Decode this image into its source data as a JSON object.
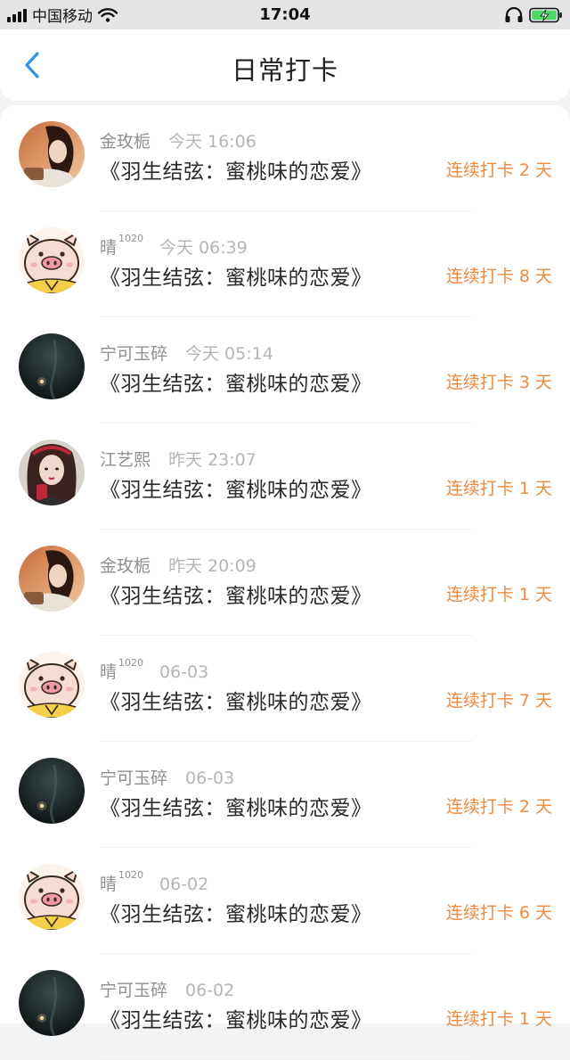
{
  "status_bar": {
    "carrier": "中国移动",
    "time": "17:04",
    "battery_charging": true
  },
  "header": {
    "title": "日常打卡",
    "back_icon": "chevron-left-icon"
  },
  "colors": {
    "accent": "#2f95e8",
    "streak": "#f08a3e",
    "name_gray": "#8f8f8f",
    "time_gray": "#b5b5b5"
  },
  "checkins": [
    {
      "name": "金玫栀",
      "name_sup": "",
      "time": "今天 16:06",
      "book": "《羽生结弦：蜜桃味的恋爱》",
      "streak": "连续打卡 2 天",
      "avatar": "girl-warm"
    },
    {
      "name": "晴",
      "name_sup": "1020",
      "time": "今天 06:39",
      "book": "《羽生结弦：蜜桃味的恋爱》",
      "streak": "连续打卡 8 天",
      "avatar": "pig"
    },
    {
      "name": "宁可玉碎",
      "name_sup": "",
      "time": "今天 05:14",
      "book": "《羽生结弦：蜜桃味的恋爱》",
      "streak": "连续打卡 3 天",
      "avatar": "dark"
    },
    {
      "name": "江艺熙",
      "name_sup": "",
      "time": "昨天 23:07",
      "book": "《羽生结弦：蜜桃味的恋爱》",
      "streak": "连续打卡 1 天",
      "avatar": "girl-red"
    },
    {
      "name": "金玫栀",
      "name_sup": "",
      "time": "昨天 20:09",
      "book": "《羽生结弦：蜜桃味的恋爱》",
      "streak": "连续打卡 1 天",
      "avatar": "girl-warm"
    },
    {
      "name": "晴",
      "name_sup": "1020",
      "time": "06-03",
      "book": "《羽生结弦：蜜桃味的恋爱》",
      "streak": "连续打卡 7 天",
      "avatar": "pig"
    },
    {
      "name": "宁可玉碎",
      "name_sup": "",
      "time": "06-03",
      "book": "《羽生结弦：蜜桃味的恋爱》",
      "streak": "连续打卡 2 天",
      "avatar": "dark"
    },
    {
      "name": "晴",
      "name_sup": "1020",
      "time": "06-02",
      "book": "《羽生结弦：蜜桃味的恋爱》",
      "streak": "连续打卡 6 天",
      "avatar": "pig"
    },
    {
      "name": "宁可玉碎",
      "name_sup": "",
      "time": "06-02",
      "book": "《羽生结弦：蜜桃味的恋爱》",
      "streak": "连续打卡 1 天",
      "avatar": "dark"
    }
  ]
}
